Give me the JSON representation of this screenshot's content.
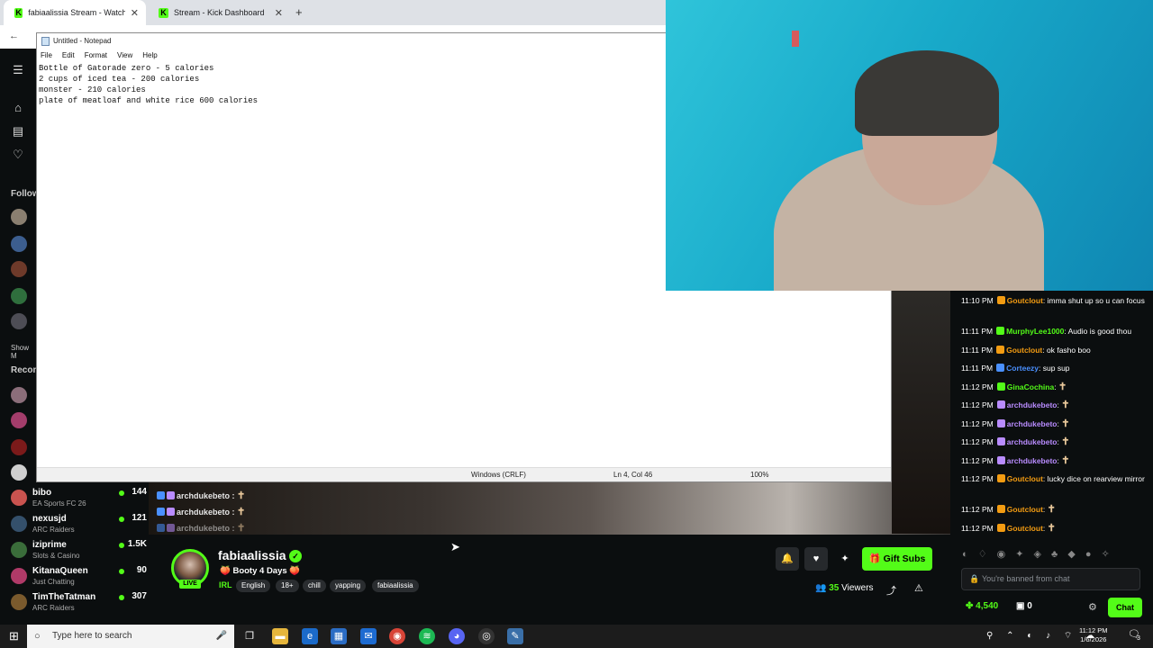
{
  "browser": {
    "tabs": [
      {
        "title": "fabiaalissia Stream - Watch Live",
        "active": true
      },
      {
        "title": "Stream - Kick Dashboard",
        "active": false
      }
    ],
    "new_tab_icon": "plus-icon",
    "back_icon": "back-arrow-icon"
  },
  "notepad": {
    "title": "Untitled - Notepad",
    "menu": [
      "File",
      "Edit",
      "Format",
      "View",
      "Help"
    ],
    "content": "Bottle of Gatorade zero - 5 calories\n2 cups of iced tea - 200 calories\nmonster - 210 calories\nplate of meatloaf and white rice 600 calories",
    "status": {
      "line_endings": "Windows (CRLF)",
      "position": "Ln 4, Col 46",
      "zoom": "100%"
    }
  },
  "sidebar": {
    "followed_label": "Follow",
    "show_more_label": "Show M",
    "recommended_label": "Recom",
    "channels": [
      {
        "name": "bibo",
        "category": "EA Sports FC 26",
        "viewers": "144"
      },
      {
        "name": "nexusjd",
        "category": "ARC Raiders",
        "viewers": "121"
      },
      {
        "name": "iziprime",
        "category": "Slots & Casino",
        "viewers": "1.5K"
      },
      {
        "name": "KitanaQueen",
        "category": "Just Chatting",
        "viewers": "90"
      },
      {
        "name": "TimTheTatman",
        "category": "ARC Raiders",
        "viewers": "307"
      }
    ]
  },
  "overlay_chat": [
    {
      "user": "archdukebeto :",
      "glyph": "✝"
    },
    {
      "user": "archdukebeto :",
      "glyph": "✝"
    },
    {
      "user": "archdukebeto :",
      "glyph": "✝"
    }
  ],
  "chat": {
    "messages": [
      {
        "time": "11:10 PM",
        "user": "Goutclout",
        "cls": "u-gold",
        "text": "imma shut up so u can focus"
      },
      {
        "time": "11:11 PM",
        "user": "MurphyLee1000",
        "cls": "u-green",
        "text": "Audio is good thou"
      },
      {
        "time": "11:11 PM",
        "user": "Goutclout",
        "cls": "u-gold",
        "text": "ok fasho boo"
      },
      {
        "time": "11:11 PM",
        "user": "Corteezy",
        "cls": "u-blue",
        "text": "sup sup"
      },
      {
        "time": "11:12 PM",
        "user": "GinaCochina",
        "cls": "u-green",
        "text": ""
      },
      {
        "time": "11:12 PM",
        "user": "archdukebeto",
        "cls": "u-purple",
        "text": ""
      },
      {
        "time": "11:12 PM",
        "user": "archdukebeto",
        "cls": "u-purple",
        "text": ""
      },
      {
        "time": "11:12 PM",
        "user": "archdukebeto",
        "cls": "u-purple",
        "text": ""
      },
      {
        "time": "11:12 PM",
        "user": "archdukebeto",
        "cls": "u-purple",
        "text": ""
      },
      {
        "time": "11:12 PM",
        "user": "Goutclout",
        "cls": "u-gold",
        "text": "lucky dice on rearview mirror"
      },
      {
        "time": "11:12 PM",
        "user": "Goutclout",
        "cls": "u-gold",
        "text": ""
      },
      {
        "time": "11:12 PM",
        "user": "Goutclout",
        "cls": "u-gold",
        "text": ""
      }
    ],
    "banned_text": "You're banned from chat",
    "points": "4,540",
    "gift_count": "0",
    "chat_button": "Chat"
  },
  "stream": {
    "streamer": "fabiaalissia",
    "title": "Booty 4 Days",
    "live_label": "LIVE",
    "category": "IRL",
    "tags": [
      "English",
      "18+",
      "chill",
      "yapping",
      "fabiaalissia"
    ],
    "viewers_count": "35",
    "viewers_label": "Viewers",
    "gift_label": "Gift Subs"
  },
  "taskbar": {
    "search_placeholder": "Type here to search",
    "time": "11:12 PM",
    "date": "1/6/2026",
    "notifications": "3"
  }
}
